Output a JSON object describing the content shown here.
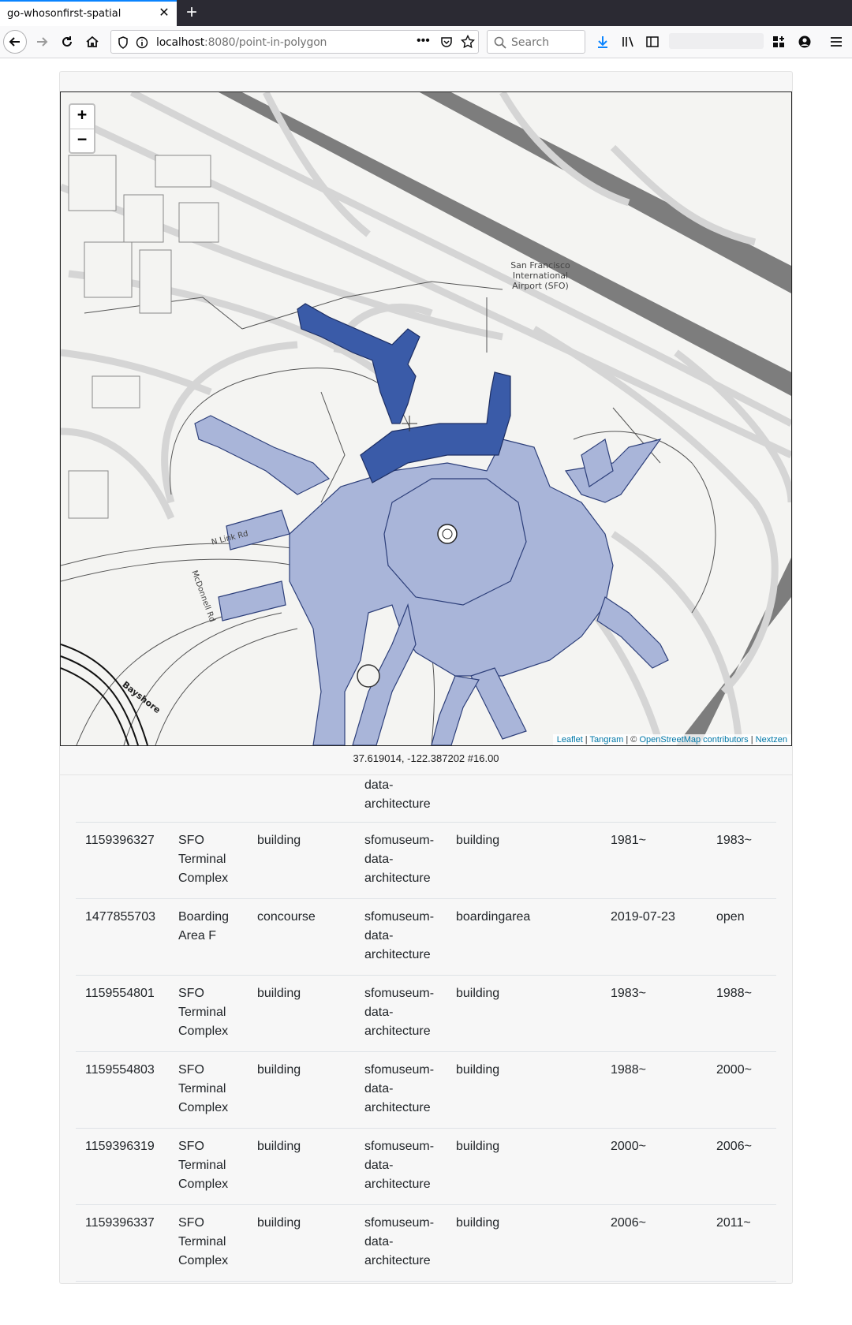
{
  "browser": {
    "tab_title": "go-whosonfirst-spatial",
    "url_host": "localhost",
    "url_rest": ":8080/point-in-polygon",
    "search_placeholder": "Search"
  },
  "map": {
    "labels": {
      "airport_line1": "San Francisco",
      "airport_line2": "International",
      "airport_line3": "Airport (SFO)",
      "road_nlink": "N Link Rd",
      "road_mcdonnell": "McDonnell Rd",
      "road_bayshore": "Bayshore"
    },
    "zoom_in": "+",
    "zoom_out": "−",
    "attribution": {
      "leaflet": "Leaflet",
      "sep1": " | ",
      "tangram": "Tangram",
      "sep2": " | © ",
      "osm": "OpenStreetMap contributors",
      "sep3": " | ",
      "nextzen": "Nextzen"
    },
    "colors": {
      "polygon_dark": "#3a5ba8",
      "polygon_light": "#a9b5d9",
      "runway": "#7d7d7d",
      "taxiway": "#d5d5d5"
    }
  },
  "coords": "37.619014, -122.387202 #16.00",
  "partial_row": {
    "repo_line1": "data-",
    "repo_line2": "architecture"
  },
  "rows": [
    {
      "id": "1159396327",
      "name": [
        "SFO",
        "Terminal",
        "Complex"
      ],
      "placetype": "building",
      "repo": [
        "sfomuseum-",
        "data-",
        "architecture"
      ],
      "category": "building",
      "from": "1981~",
      "to": "1983~"
    },
    {
      "id": "1477855703",
      "name": [
        "Boarding",
        "Area F"
      ],
      "placetype": "concourse",
      "repo": [
        "sfomuseum-",
        "data-",
        "architecture"
      ],
      "category": "boardingarea",
      "from": "2019-07-23",
      "to": "open"
    },
    {
      "id": "1159554801",
      "name": [
        "SFO",
        "Terminal",
        "Complex"
      ],
      "placetype": "building",
      "repo": [
        "sfomuseum-",
        "data-",
        "architecture"
      ],
      "category": "building",
      "from": "1983~",
      "to": "1988~"
    },
    {
      "id": "1159554803",
      "name": [
        "SFO",
        "Terminal",
        "Complex"
      ],
      "placetype": "building",
      "repo": [
        "sfomuseum-",
        "data-",
        "architecture"
      ],
      "category": "building",
      "from": "1988~",
      "to": "2000~"
    },
    {
      "id": "1159396319",
      "name": [
        "SFO",
        "Terminal",
        "Complex"
      ],
      "placetype": "building",
      "repo": [
        "sfomuseum-",
        "data-",
        "architecture"
      ],
      "category": "building",
      "from": "2000~",
      "to": "2006~"
    },
    {
      "id": "1159396337",
      "name": [
        "SFO",
        "Terminal",
        "Complex"
      ],
      "placetype": "building",
      "repo": [
        "sfomuseum-",
        "data-",
        "architecture"
      ],
      "category": "building",
      "from": "2006~",
      "to": "2011~"
    }
  ]
}
